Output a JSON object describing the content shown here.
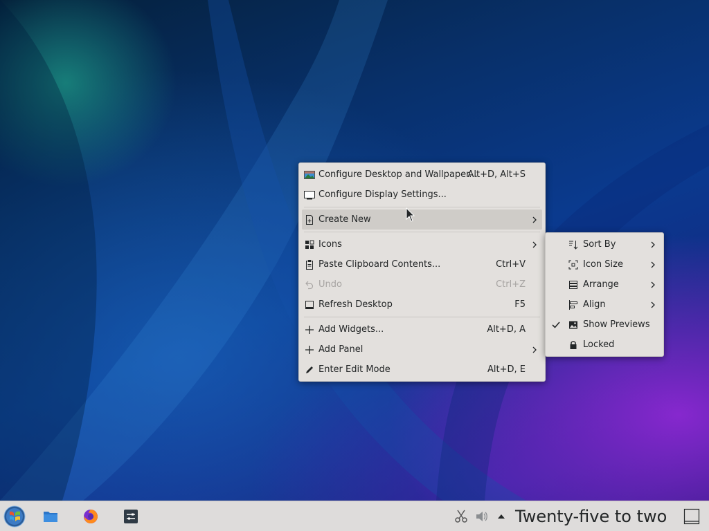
{
  "main_menu": {
    "items": [
      {
        "label": "Configure Desktop and Wallpaper...",
        "shortcut": "Alt+D, Alt+S",
        "icon": "wallpaper-icon"
      },
      {
        "label": "Configure Display Settings...",
        "shortcut": "",
        "icon": "display-icon"
      },
      {
        "label": "Create New",
        "shortcut": "",
        "icon": "new-file-icon",
        "submenu": true
      },
      {
        "label": "Icons",
        "shortcut": "",
        "icon": "grid-icon",
        "submenu": true
      },
      {
        "label": "Paste Clipboard Contents...",
        "shortcut": "Ctrl+V",
        "icon": "clipboard-icon"
      },
      {
        "label": "Undo",
        "shortcut": "Ctrl+Z",
        "icon": "undo-icon",
        "disabled": true
      },
      {
        "label": "Refresh Desktop",
        "shortcut": "F5",
        "icon": "refresh-icon"
      },
      {
        "label": "Add Widgets...",
        "shortcut": "Alt+D, A",
        "icon": "plus-icon"
      },
      {
        "label": "Add Panel",
        "shortcut": "",
        "icon": "plus-icon",
        "submenu": true
      },
      {
        "label": "Enter Edit Mode",
        "shortcut": "Alt+D, E",
        "icon": "pencil-icon"
      }
    ]
  },
  "icons_submenu": {
    "items": [
      {
        "label": "Sort By",
        "icon": "sort-icon",
        "submenu": true
      },
      {
        "label": "Icon Size",
        "icon": "icon-size-icon",
        "submenu": true
      },
      {
        "label": "Arrange",
        "icon": "arrange-icon",
        "submenu": true
      },
      {
        "label": "Align",
        "icon": "align-icon",
        "submenu": true
      },
      {
        "label": "Show Previews",
        "icon": "image-icon",
        "checked": true
      },
      {
        "label": "Locked",
        "icon": "lock-icon",
        "checked": false
      }
    ]
  },
  "taskbar": {
    "clock": "Twenty-five to two",
    "launchers": [
      "app-launcher-icon",
      "file-manager-icon",
      "firefox-icon",
      "system-settings-icon"
    ],
    "tray": [
      "scissors-icon",
      "volume-icon",
      "expand-tray-icon"
    ]
  },
  "colors": {
    "menu_bg": "#e3e0dd",
    "highlight": "#cfccc8",
    "disabled_text": "#a7a4a2",
    "taskbar_bg": "#dedcdb"
  }
}
